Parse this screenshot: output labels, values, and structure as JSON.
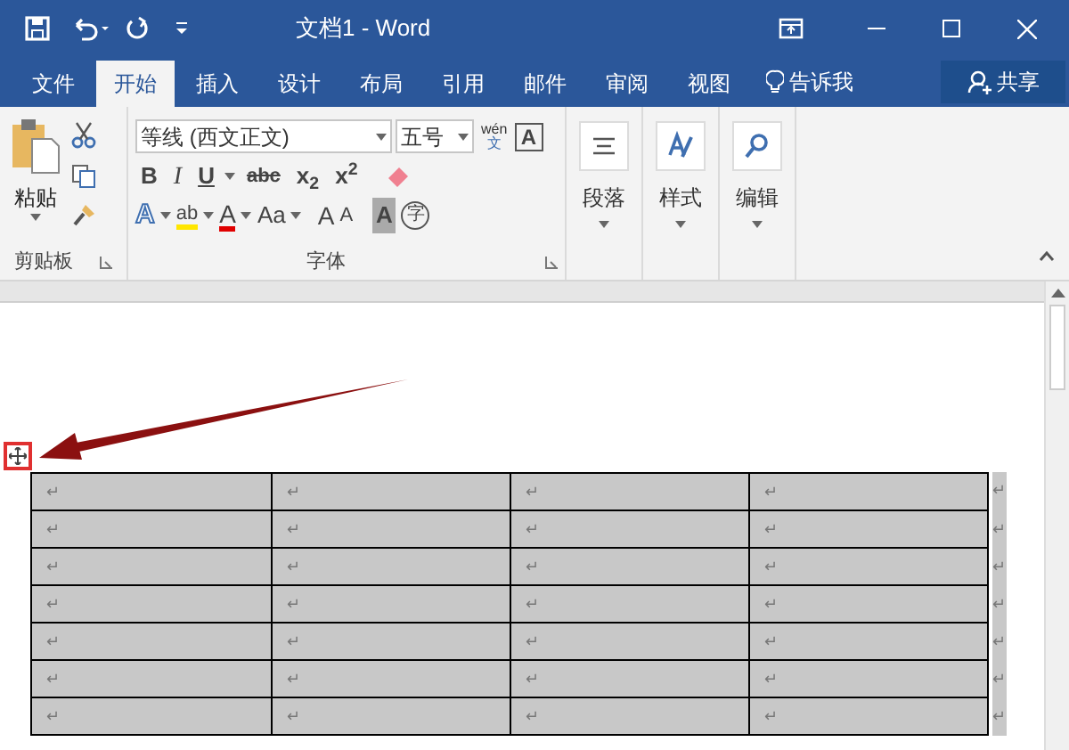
{
  "window": {
    "title": "文档1 - Word"
  },
  "tabs": [
    {
      "label": "文件",
      "selected": false
    },
    {
      "label": "开始",
      "selected": true
    },
    {
      "label": "插入",
      "selected": false
    },
    {
      "label": "设计",
      "selected": false
    },
    {
      "label": "布局",
      "selected": false
    },
    {
      "label": "引用",
      "selected": false
    },
    {
      "label": "邮件",
      "selected": false
    },
    {
      "label": "审阅",
      "selected": false
    },
    {
      "label": "视图",
      "selected": false
    }
  ],
  "tell_me": "告诉我",
  "share": "共享",
  "clipboard": {
    "paste": "粘贴",
    "label": "剪贴板"
  },
  "font": {
    "font_name": "等线 (西文正文)",
    "font_size": "五号",
    "phonetic_top": "wén",
    "phonetic_bottom": "文",
    "border_char": "A",
    "label": "字体",
    "row_2": [
      {
        "kind": "bold",
        "label": "B"
      },
      {
        "kind": "italic",
        "label": "I"
      },
      {
        "kind": "underline",
        "label": "U"
      },
      {
        "kind": "strike",
        "label": "abc"
      },
      {
        "kind": "sub",
        "label": "x",
        "mark": "2"
      },
      {
        "kind": "sup",
        "label": "x",
        "mark": "2"
      }
    ],
    "row_3": [
      {
        "kind": "effects",
        "label": "A"
      },
      {
        "kind": "highlight",
        "label": "ab"
      },
      {
        "kind": "color",
        "label": "A"
      },
      {
        "kind": "case",
        "label": "Aa"
      },
      {
        "kind": "grow",
        "label": "A"
      },
      {
        "kind": "shrink",
        "label": "A"
      },
      {
        "kind": "shade",
        "label": "A"
      },
      {
        "kind": "enclose",
        "label": "字"
      }
    ]
  },
  "groups": [
    {
      "kind": "paragraph",
      "label": "段落"
    },
    {
      "kind": "styles",
      "label": "样式"
    },
    {
      "kind": "editing",
      "label": "编辑"
    }
  ],
  "table": {
    "rows": [
      {
        "selected": true,
        "cells": [
          "↵",
          "↵",
          "↵",
          "↵"
        ],
        "end_mark": "↵"
      },
      {
        "selected": true,
        "cells": [
          "↵",
          "↵",
          "↵",
          "↵"
        ],
        "end_mark": "↵"
      },
      {
        "selected": true,
        "cells": [
          "↵",
          "↵",
          "↵",
          "↵"
        ],
        "end_mark": "↵"
      },
      {
        "selected": true,
        "cells": [
          "↵",
          "↵",
          "↵",
          "↵"
        ],
        "end_mark": "↵"
      },
      {
        "selected": true,
        "cells": [
          "↵",
          "↵",
          "↵",
          "↵"
        ],
        "end_mark": "↵"
      },
      {
        "selected": true,
        "cells": [
          "↵",
          "↵",
          "↵",
          "↵"
        ],
        "end_mark": "↵"
      },
      {
        "selected": true,
        "cells": [
          "↵",
          "↵",
          "↵",
          "↵"
        ],
        "end_mark": "↵"
      }
    ]
  }
}
